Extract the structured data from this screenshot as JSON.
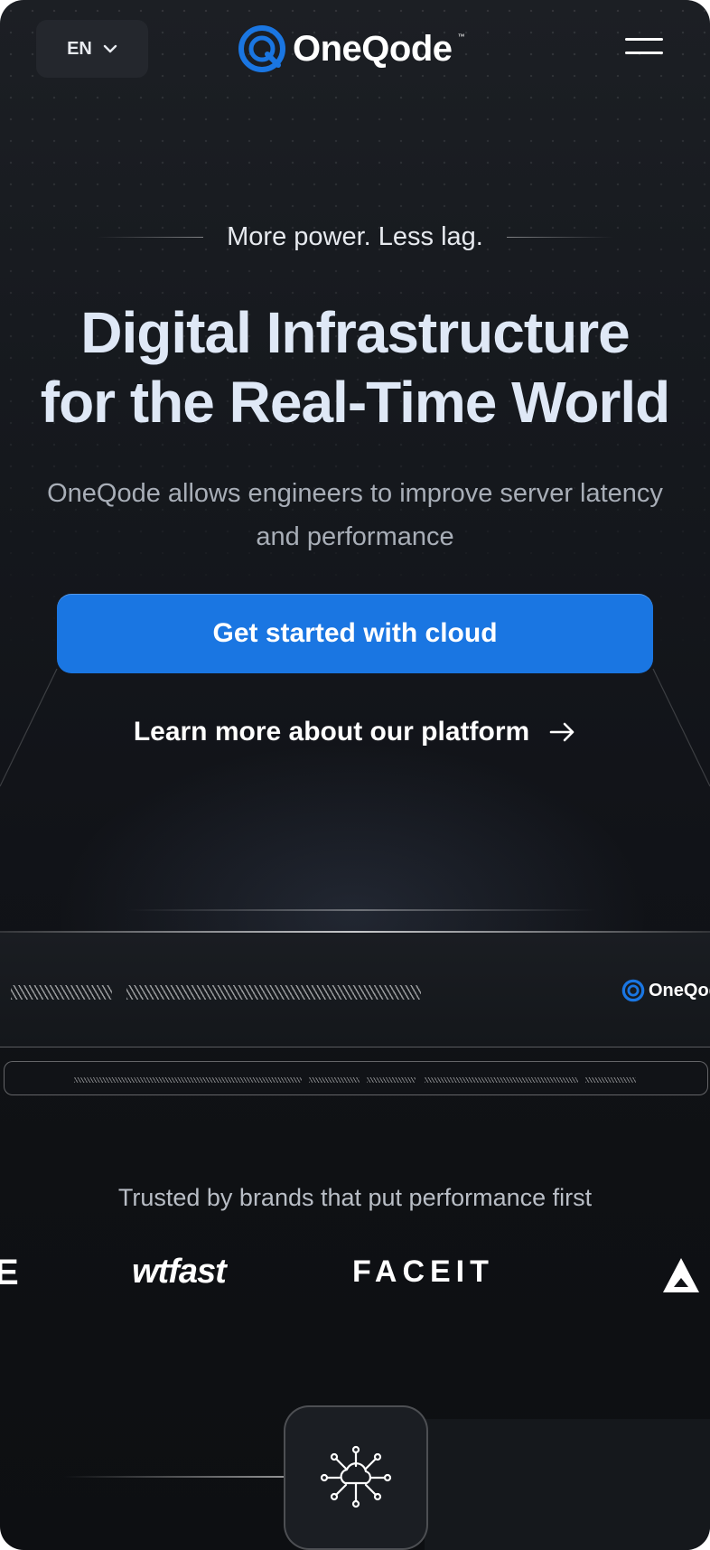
{
  "header": {
    "language": "EN",
    "logo_text": "OneQode",
    "logo_tm": "™"
  },
  "hero": {
    "tagline": "More power. Less lag.",
    "headline_line1": "Digital Infrastructure",
    "headline_line2": "for the Real-Time World",
    "subtitle": "OneQode allows engineers to improve server latency and performance",
    "cta_label": "Get started with cloud",
    "learn_more_label": "Learn more about our platform"
  },
  "rack": {
    "logo_text": "OneQode"
  },
  "trusted": {
    "heading": "Trusted by brands that put performance first",
    "brands": [
      "E",
      "wtfast",
      "FACEIT",
      "A"
    ]
  },
  "colors": {
    "accent": "#1a76e2",
    "background": "#111318",
    "headline": "#dfe8f6"
  },
  "icons": [
    "chevron-down-icon",
    "menu-icon",
    "arrow-right-icon",
    "cloud-network-icon",
    "oneqode-logo-icon"
  ]
}
